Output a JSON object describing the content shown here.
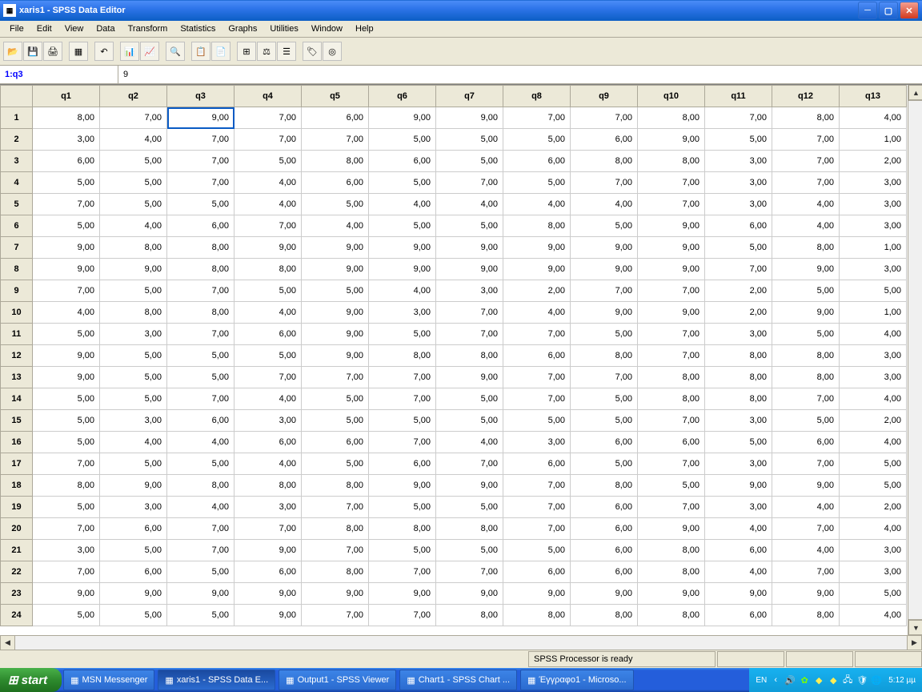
{
  "title": "xaris1 - SPSS Data Editor",
  "menu": [
    "File",
    "Edit",
    "View",
    "Data",
    "Transform",
    "Statistics",
    "Graphs",
    "Utilities",
    "Window",
    "Help"
  ],
  "cellref": {
    "ref": "1:q3",
    "val": "9"
  },
  "columns": [
    "q1",
    "q2",
    "q3",
    "q4",
    "q5",
    "q6",
    "q7",
    "q8",
    "q9",
    "q10",
    "q11",
    "q12",
    "q13"
  ],
  "rows": [
    [
      "8,00",
      "7,00",
      "9,00",
      "7,00",
      "6,00",
      "9,00",
      "9,00",
      "7,00",
      "7,00",
      "8,00",
      "7,00",
      "8,00",
      "4,00"
    ],
    [
      "3,00",
      "4,00",
      "7,00",
      "7,00",
      "7,00",
      "5,00",
      "5,00",
      "5,00",
      "6,00",
      "9,00",
      "5,00",
      "7,00",
      "1,00"
    ],
    [
      "6,00",
      "5,00",
      "7,00",
      "5,00",
      "8,00",
      "6,00",
      "5,00",
      "6,00",
      "8,00",
      "8,00",
      "3,00",
      "7,00",
      "2,00"
    ],
    [
      "5,00",
      "5,00",
      "7,00",
      "4,00",
      "6,00",
      "5,00",
      "7,00",
      "5,00",
      "7,00",
      "7,00",
      "3,00",
      "7,00",
      "3,00"
    ],
    [
      "7,00",
      "5,00",
      "5,00",
      "4,00",
      "5,00",
      "4,00",
      "4,00",
      "4,00",
      "4,00",
      "7,00",
      "3,00",
      "4,00",
      "3,00"
    ],
    [
      "5,00",
      "4,00",
      "6,00",
      "7,00",
      "4,00",
      "5,00",
      "5,00",
      "8,00",
      "5,00",
      "9,00",
      "6,00",
      "4,00",
      "3,00"
    ],
    [
      "9,00",
      "8,00",
      "8,00",
      "9,00",
      "9,00",
      "9,00",
      "9,00",
      "9,00",
      "9,00",
      "9,00",
      "5,00",
      "8,00",
      "1,00"
    ],
    [
      "9,00",
      "9,00",
      "8,00",
      "8,00",
      "9,00",
      "9,00",
      "9,00",
      "9,00",
      "9,00",
      "9,00",
      "7,00",
      "9,00",
      "3,00"
    ],
    [
      "7,00",
      "5,00",
      "7,00",
      "5,00",
      "5,00",
      "4,00",
      "3,00",
      "2,00",
      "7,00",
      "7,00",
      "2,00",
      "5,00",
      "5,00"
    ],
    [
      "4,00",
      "8,00",
      "8,00",
      "4,00",
      "9,00",
      "3,00",
      "7,00",
      "4,00",
      "9,00",
      "9,00",
      "2,00",
      "9,00",
      "1,00"
    ],
    [
      "5,00",
      "3,00",
      "7,00",
      "6,00",
      "9,00",
      "5,00",
      "7,00",
      "7,00",
      "5,00",
      "7,00",
      "3,00",
      "5,00",
      "4,00"
    ],
    [
      "9,00",
      "5,00",
      "5,00",
      "5,00",
      "9,00",
      "8,00",
      "8,00",
      "6,00",
      "8,00",
      "7,00",
      "8,00",
      "8,00",
      "3,00"
    ],
    [
      "9,00",
      "5,00",
      "5,00",
      "7,00",
      "7,00",
      "7,00",
      "9,00",
      "7,00",
      "7,00",
      "8,00",
      "8,00",
      "8,00",
      "3,00"
    ],
    [
      "5,00",
      "5,00",
      "7,00",
      "4,00",
      "5,00",
      "7,00",
      "5,00",
      "7,00",
      "5,00",
      "8,00",
      "8,00",
      "7,00",
      "4,00"
    ],
    [
      "5,00",
      "3,00",
      "6,00",
      "3,00",
      "5,00",
      "5,00",
      "5,00",
      "5,00",
      "5,00",
      "7,00",
      "3,00",
      "5,00",
      "2,00"
    ],
    [
      "5,00",
      "4,00",
      "4,00",
      "6,00",
      "6,00",
      "7,00",
      "4,00",
      "3,00",
      "6,00",
      "6,00",
      "5,00",
      "6,00",
      "4,00"
    ],
    [
      "7,00",
      "5,00",
      "5,00",
      "4,00",
      "5,00",
      "6,00",
      "7,00",
      "6,00",
      "5,00",
      "7,00",
      "3,00",
      "7,00",
      "5,00"
    ],
    [
      "8,00",
      "9,00",
      "8,00",
      "8,00",
      "8,00",
      "9,00",
      "9,00",
      "7,00",
      "8,00",
      "5,00",
      "9,00",
      "9,00",
      "5,00"
    ],
    [
      "5,00",
      "3,00",
      "4,00",
      "3,00",
      "7,00",
      "5,00",
      "5,00",
      "7,00",
      "6,00",
      "7,00",
      "3,00",
      "4,00",
      "2,00"
    ],
    [
      "7,00",
      "6,00",
      "7,00",
      "7,00",
      "8,00",
      "8,00",
      "8,00",
      "7,00",
      "6,00",
      "9,00",
      "4,00",
      "7,00",
      "4,00"
    ],
    [
      "3,00",
      "5,00",
      "7,00",
      "9,00",
      "7,00",
      "5,00",
      "5,00",
      "5,00",
      "6,00",
      "8,00",
      "6,00",
      "4,00",
      "3,00"
    ],
    [
      "7,00",
      "6,00",
      "5,00",
      "6,00",
      "8,00",
      "7,00",
      "7,00",
      "6,00",
      "6,00",
      "8,00",
      "4,00",
      "7,00",
      "3,00"
    ],
    [
      "9,00",
      "9,00",
      "9,00",
      "9,00",
      "9,00",
      "9,00",
      "9,00",
      "9,00",
      "9,00",
      "9,00",
      "9,00",
      "9,00",
      "5,00"
    ],
    [
      "5,00",
      "5,00",
      "5,00",
      "9,00",
      "7,00",
      "7,00",
      "8,00",
      "8,00",
      "8,00",
      "8,00",
      "6,00",
      "8,00",
      "4,00"
    ]
  ],
  "selected": {
    "row": 0,
    "col": 2
  },
  "status": "SPSS Processor is ready",
  "taskbar": {
    "start": "start",
    "items": [
      {
        "label": "MSN Messenger",
        "active": false
      },
      {
        "label": "xaris1 - SPSS Data E...",
        "active": true
      },
      {
        "label": "Output1 - SPSS Viewer",
        "active": false
      },
      {
        "label": "Chart1 - SPSS Chart ...",
        "active": false
      },
      {
        "label": "Έγγραφο1 - Microso...",
        "active": false
      }
    ],
    "lang": "EN",
    "clock": "5:12 µµ"
  }
}
